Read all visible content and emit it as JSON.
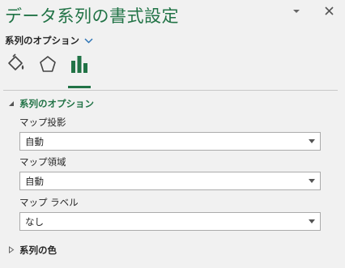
{
  "pane": {
    "title": "データ系列の書式設定",
    "options_menu_label": "系列のオプション"
  },
  "icons": {
    "fill": "paint-bucket-icon",
    "effects": "pentagon-icon",
    "series": "bar-chart-icon"
  },
  "sections": {
    "series_options": {
      "title": "系列のオプション",
      "fields": [
        {
          "label": "マップ投影",
          "value": "自動"
        },
        {
          "label": "マップ領域",
          "value": "自動"
        },
        {
          "label": "マップ ラベル",
          "value": "なし"
        }
      ]
    },
    "series_color": {
      "title": "系列の色"
    }
  },
  "colors": {
    "accent": "#217346",
    "background": "#f1f1f1"
  }
}
